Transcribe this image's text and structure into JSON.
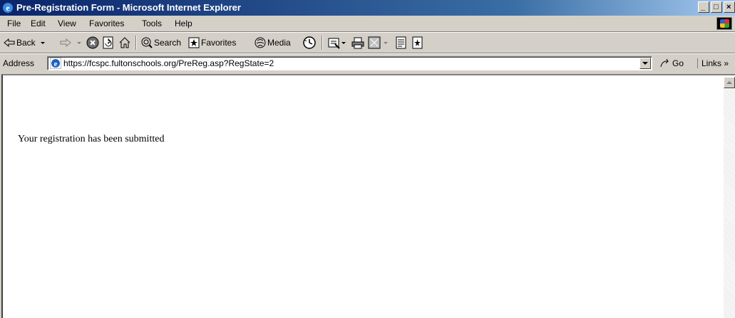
{
  "window": {
    "title": "Pre-Registration Form - Microsoft Internet Explorer"
  },
  "menu": [
    "File",
    "Edit",
    "View",
    "Favorites",
    "Tools",
    "Help"
  ],
  "toolbar": {
    "back_label": "Back",
    "search_label": "Search",
    "favorites_label": "Favorites",
    "media_label": "Media"
  },
  "address": {
    "label": "Address",
    "url": "https://fcspc.fultonschools.org/PreReg.asp?RegState=2",
    "go_label": "Go",
    "links_label": "Links »"
  },
  "content": {
    "message": "Your registration has been submitted"
  },
  "colors": {
    "titlebar": "#0a246a",
    "chrome": "#d4d0c8",
    "page": "#ffffff"
  }
}
